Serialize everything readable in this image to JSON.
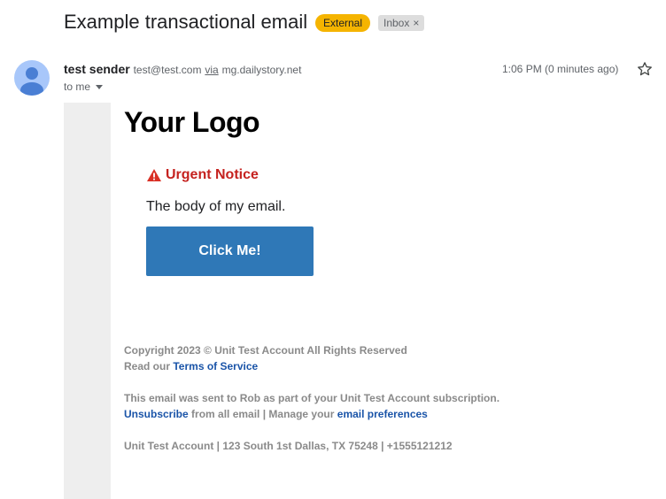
{
  "subject": "Example transactional email",
  "badges": {
    "external": "External",
    "inbox": "Inbox",
    "inbox_close": "×"
  },
  "sender": {
    "name": "test sender",
    "email": "test@test.com",
    "via_label": "via",
    "via_domain": "mg.dailystory.net"
  },
  "recipient": "to me",
  "timestamp": "1:06 PM (0 minutes ago)",
  "icons": {
    "avatar": "person-avatar-icon",
    "star": "star-icon",
    "warning": "warning-icon",
    "caret": "chevron-down-icon"
  },
  "email": {
    "logo": "Your Logo",
    "notice": "Urgent Notice",
    "body": "The body of my email.",
    "button": "Click Me!",
    "footer": {
      "copyright": "Copyright 2023 © Unit Test Account All Rights Reserved",
      "read_our": "Read our",
      "tos_link": "Terms of Service",
      "sent_to": "This email was sent to Rob as part of your Unit Test Account subscription.",
      "unsubscribe_link": "Unsubscribe",
      "unsubscribe_rest": "from all email | Manage your",
      "prefs_link": "email preferences",
      "address": "Unit Test Account | 123 South 1st Dallas, TX 75248 | +1555121212"
    }
  },
  "colors": {
    "external_badge": "#f5b400",
    "notice": "#c5221f",
    "button": "#2f78b7",
    "link": "#1a54a8"
  }
}
